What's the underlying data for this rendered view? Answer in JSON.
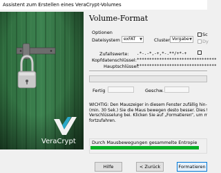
{
  "window": {
    "title": "Assistent zum Erstellen eines VeraCrypt-Volumes"
  },
  "sidebar": {
    "logo_text": "VeraCrypt"
  },
  "page": {
    "title": "Volume-Format"
  },
  "options": {
    "group_label": "Optionen",
    "filesystem_label": "Dateisystem",
    "filesystem_value": "exFAT",
    "cluster_label": "Cluster",
    "cluster_value": "Vorgabe",
    "quick_format_label": "Sc",
    "dynamic_label": "Dy"
  },
  "keys": {
    "random_label": "Zufallswerte:",
    "random_value": ".*-.-*,-+,*-.**/+*-+",
    "header_key_label": "Kopfdatenschlüssel:",
    "header_key_value": "********************************",
    "master_key_label": "Hauptschlüssel:",
    "master_key_value": "********************************"
  },
  "progress": {
    "done_label": "Fertig",
    "speed_label": "Geschw.",
    "percent_done": 0
  },
  "warning": {
    "lines": [
      "WICHTIG: Den Mauszeiger in diesem Fenster zufällig hin- und h",
      "(min. 30 Sek.) Sie die Maus bewegen desto besser. Dies trägt",
      "Verschlüsselung bei. Klicken Sie auf „Formatieren“, um mit der",
      "fortzufahren."
    ]
  },
  "entropy": {
    "label": "Durch Mausbewegungen gesammelte Entropie",
    "level": 0.93,
    "color": "#06b025"
  },
  "buttons": {
    "help": "Hilfe",
    "back": "< Zurück",
    "format": "Formatieren"
  }
}
